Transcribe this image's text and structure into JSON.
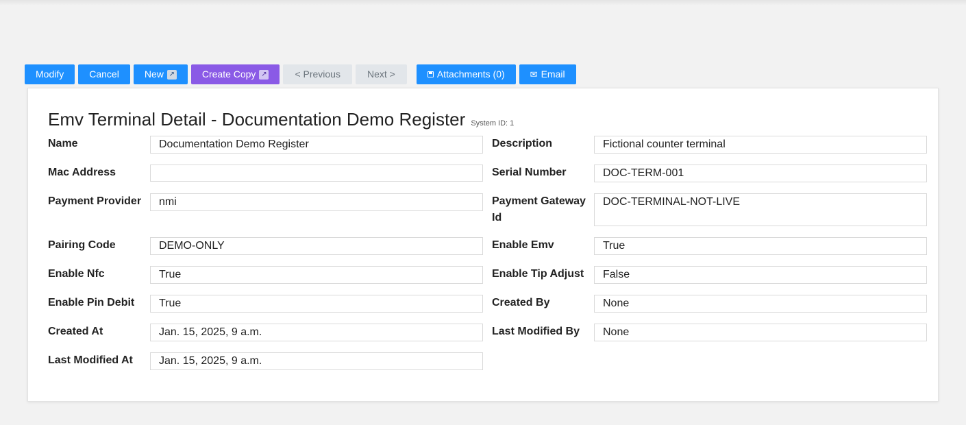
{
  "toolbar": {
    "modify": "Modify",
    "cancel": "Cancel",
    "new": "New",
    "create_copy": "Create Copy",
    "previous": "< Previous",
    "next": "Next >",
    "attachments": "Attachments (0)",
    "email": "Email"
  },
  "page": {
    "title": "Emv Terminal Detail - Documentation Demo Register",
    "system_id": "System ID: 1"
  },
  "fields": {
    "name": {
      "label": "Name",
      "value": "Documentation Demo Register"
    },
    "description": {
      "label": "Description",
      "value": "Fictional counter terminal"
    },
    "mac_address": {
      "label": "Mac Address",
      "value": ""
    },
    "serial_number": {
      "label": "Serial Number",
      "value": "DOC-TERM-001"
    },
    "payment_provider": {
      "label": "Payment Provider",
      "value": "nmi"
    },
    "payment_gateway_id": {
      "label_line1": "Payment Gateway",
      "label_line2": "Id",
      "value": "DOC-TERMINAL-NOT-LIVE"
    },
    "pairing_code": {
      "label": "Pairing Code",
      "value": "DEMO-ONLY"
    },
    "enable_emv": {
      "label": "Enable Emv",
      "value": "True"
    },
    "enable_nfc": {
      "label": "Enable Nfc",
      "value": "True"
    },
    "enable_tip_adjust": {
      "label": "Enable Tip Adjust",
      "value": "False"
    },
    "enable_pin_debit": {
      "label": "Enable Pin Debit",
      "value": "True"
    },
    "created_by": {
      "label": "Created By",
      "value": "None"
    },
    "created_at": {
      "label": "Created At",
      "value": "Jan. 15, 2025, 9 a.m."
    },
    "last_modified_by": {
      "label": "Last Modified By",
      "value": "None"
    },
    "last_modified_at": {
      "label": "Last Modified At",
      "value": "Jan. 15, 2025, 9 a.m."
    }
  },
  "colors": {
    "primary": "#1e90ff",
    "purple": "#8a5ae6",
    "disabled": "#e2e6ea"
  }
}
